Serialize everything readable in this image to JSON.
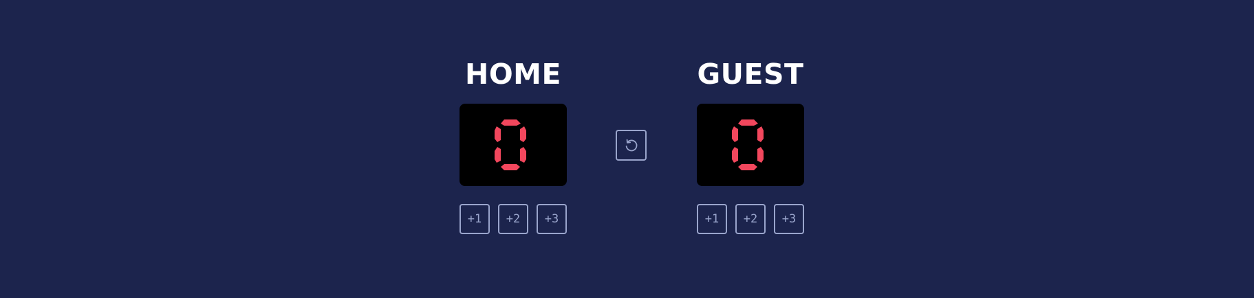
{
  "home": {
    "title": "HOME",
    "score": "0",
    "buttons": [
      {
        "label": "+1"
      },
      {
        "label": "+2"
      },
      {
        "label": "+3"
      }
    ]
  },
  "guest": {
    "title": "GUEST",
    "score": "0",
    "buttons": [
      {
        "label": "+1"
      },
      {
        "label": "+2"
      },
      {
        "label": "+3"
      }
    ]
  },
  "reset": {
    "icon": "reset-icon"
  },
  "colors": {
    "background": "#1c244d",
    "display": "#000000",
    "digit": "#f2475d",
    "button_border": "#9aa5cc",
    "title": "#ffffff"
  }
}
